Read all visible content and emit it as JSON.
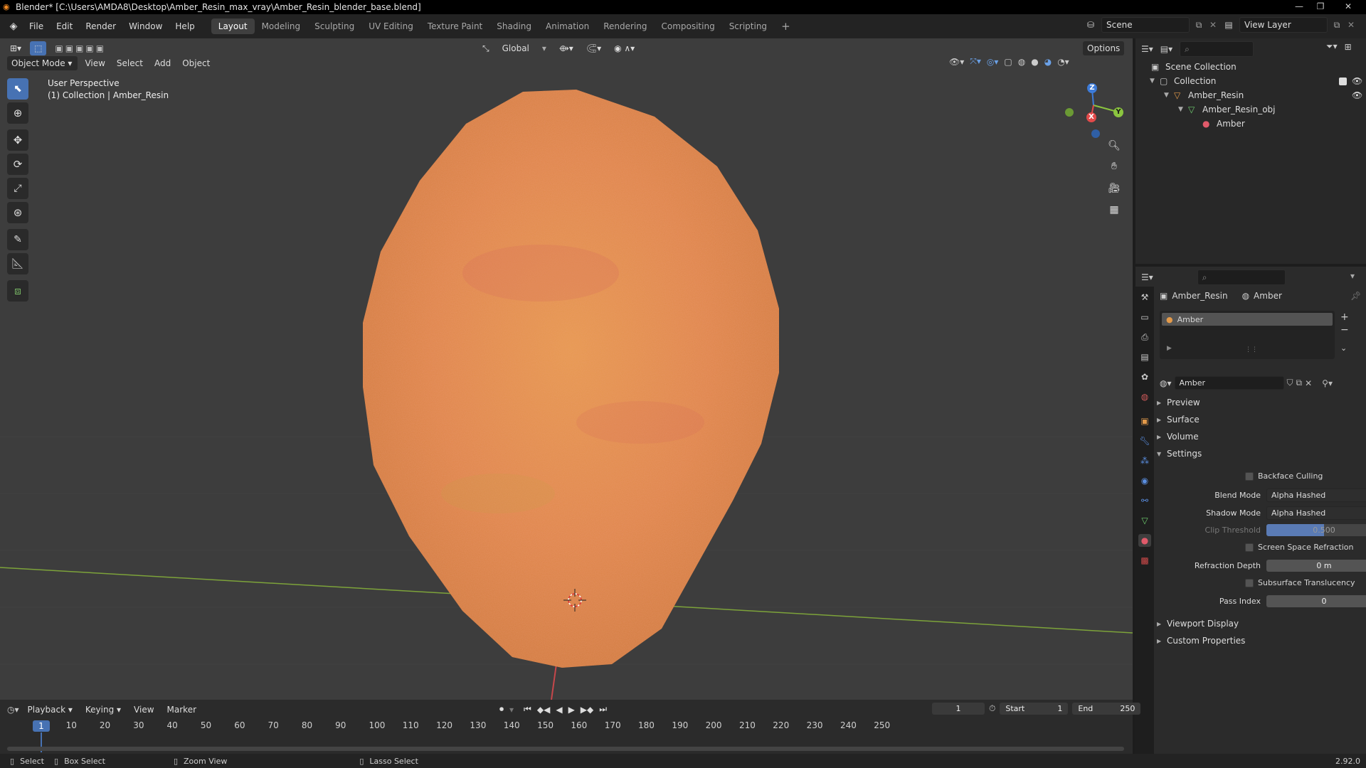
{
  "window": {
    "title": "Blender* [C:\\Users\\AMDA8\\Desktop\\Amber_Resin_max_vray\\Amber_Resin_blender_base.blend]"
  },
  "menu": [
    "File",
    "Edit",
    "Render",
    "Window",
    "Help"
  ],
  "workspaces": [
    "Layout",
    "Modeling",
    "Sculpting",
    "UV Editing",
    "Texture Paint",
    "Shading",
    "Animation",
    "Rendering",
    "Compositing",
    "Scripting"
  ],
  "active_workspace": "Layout",
  "scene": {
    "name": "Scene",
    "view_layer": "View Layer"
  },
  "tool_header": {
    "orientation": "Global",
    "options": "Options"
  },
  "viewport_header": {
    "mode": "Object Mode",
    "view": "View",
    "select": "Select",
    "add": "Add",
    "object": "Object"
  },
  "viewport": {
    "perspective": "User Perspective",
    "collection_info": "(1) Collection | Amber_Resin",
    "gizmo": {
      "x": "X",
      "y": "Y",
      "z": "Z"
    }
  },
  "outliner": {
    "items": [
      {
        "label": "Scene Collection",
        "icon": "scene-collection-icon"
      },
      {
        "label": "Collection",
        "icon": "collection-icon"
      },
      {
        "label": "Amber_Resin",
        "icon": "object-icon"
      },
      {
        "label": "Amber_Resin_obj",
        "icon": "mesh-data-icon"
      },
      {
        "label": "Amber",
        "icon": "material-icon"
      }
    ]
  },
  "properties": {
    "breadcrumb_object": "Amber_Resin",
    "breadcrumb_material": "Amber",
    "slot_name": "Amber",
    "material_name": "Amber",
    "panels": {
      "preview": "Preview",
      "surface": "Surface",
      "volume": "Volume",
      "settings": "Settings",
      "viewport_display": "Viewport Display",
      "custom_properties": "Custom Properties"
    },
    "settings": {
      "backface_culling": "Backface Culling",
      "blend_mode_label": "Blend Mode",
      "blend_mode": "Alpha Hashed",
      "shadow_mode_label": "Shadow Mode",
      "shadow_mode": "Alpha Hashed",
      "clip_threshold_label": "Clip Threshold",
      "clip_threshold": "0.500",
      "ssr_label": "Screen Space Refraction",
      "refraction_depth_label": "Refraction Depth",
      "refraction_depth": "0 m",
      "subsurface_label": "Subsurface Translucency",
      "pass_index_label": "Pass Index",
      "pass_index": "0"
    }
  },
  "timeline": {
    "playback": "Playback",
    "keying": "Keying",
    "view": "View",
    "marker": "Marker",
    "current_frame": "1",
    "start_label": "Start",
    "start": "1",
    "end_label": "End",
    "end": "250",
    "ticks": [
      "10",
      "20",
      "30",
      "40",
      "50",
      "60",
      "70",
      "80",
      "90",
      "100",
      "110",
      "120",
      "130",
      "140",
      "150",
      "160",
      "170",
      "180",
      "190",
      "200",
      "210",
      "220",
      "230",
      "240",
      "250"
    ]
  },
  "statusbar": {
    "select": "Select",
    "box_select": "Box Select",
    "zoom_view": "Zoom View",
    "lasso_select": "Lasso Select",
    "version": "2.92.0"
  },
  "colors": {
    "accent": "#4772b3",
    "amber_base": "#e08a48",
    "x_axis": "#e24a4a",
    "y_axis": "#8bc53f",
    "z_axis": "#3d7bd8"
  }
}
